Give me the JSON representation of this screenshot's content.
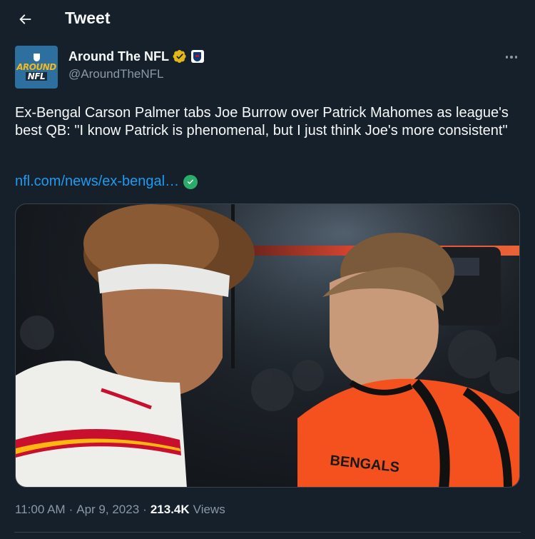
{
  "header": {
    "title": "Tweet"
  },
  "tweet": {
    "author": {
      "display_name": "Around The NFL",
      "handle": "@AroundTheNFL",
      "avatar_text_line1": "AROUND",
      "avatar_text_line2": "NFL"
    },
    "text": "Ex-Bengal Carson Palmer tabs Joe Burrow over Patrick Mahomes as league's best QB: \"I know Patrick is phenomenal, but I just think Joe's more consistent\"",
    "link_text": "nfl.com/news/ex-bengal…",
    "media_overlay": {
      "jersey_text": "BENGALS"
    },
    "time": "11:00 AM",
    "date": "Apr 9, 2023",
    "views_count": "213.4K",
    "views_label": "Views",
    "separator": "·"
  },
  "colors": {
    "background": "#15202b",
    "text_primary": "#f7f9f9",
    "text_secondary": "#8b98a5",
    "link": "#1d9bf0",
    "verified_gold": "#e2b719",
    "link_check": "#2aad6a",
    "divider": "#38444d"
  },
  "icons": {
    "back": "arrow-left-icon",
    "verified": "verified-gold-badge-icon",
    "affiliation": "nfl-shield-icon",
    "more": "more-dots-icon",
    "link_verified": "check-circle-icon"
  }
}
